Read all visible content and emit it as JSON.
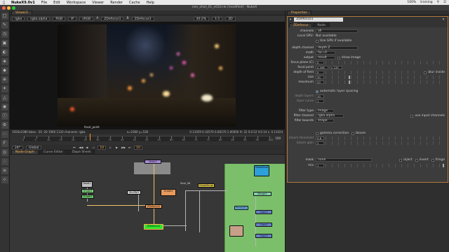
{
  "menubar": {
    "app": "NukeX9.0v1",
    "items": [
      "File",
      "Edit",
      "Workspace",
      "Viewer",
      "Render",
      "Cache",
      "Help"
    ],
    "right": {
      "status": "100%",
      "user": "training"
    }
  },
  "window_title": "nen_shot_01_v010.nk [modified] - NukeX",
  "viewer": {
    "tab": "Viewer1",
    "toolbar": {
      "layer": "rgba",
      "channel": "rgba.alpha",
      "colorspace_label": "RGB",
      "ip": "IP",
      "lut": "sRGB",
      "input_a": "A",
      "input_a_node": "ZDefocus1",
      "input_b": "B",
      "input_b_node": "ZDefocus1",
      "zoom": "40.2%",
      "aspect": "1:1",
      "mode": "2D"
    },
    "focus_point_label": "focal_point",
    "status_left": "1920x1080 bbox: -20 -20 1960 1120 channels: rgba",
    "status_mid": "x=1060 y=530",
    "status_right": "0.11059 0.10570 0.08170 1.00000  H: 32 S:0.52 V:0.14 L: 0.11024",
    "timeline_ticks": [
      "1",
      "5",
      "10",
      "15",
      "20",
      "25",
      "30",
      "35",
      "40",
      "45",
      "50",
      "55",
      "60",
      "65",
      "70",
      "75",
      "80",
      "85",
      "90",
      "95",
      "100"
    ],
    "timeline_end": "100",
    "playback": {
      "fps": "24*",
      "mode": "Global",
      "frame": "10",
      "step": "10"
    }
  },
  "nodegraph": {
    "tabs": [
      "Node Graph",
      "Curve Editor",
      "Dope Sheet"
    ],
    "nodes": {
      "read1": "Read1",
      "write": "Write1",
      "grade": "Grade1",
      "zdefocus": "ZDefocus1",
      "merge": "Merge1",
      "shuffle": "Shuffle1",
      "dot_label": "Shot_08",
      "deepmerge": "DeepMerge",
      "deepread": "DeepRead",
      "premult": "Premult1",
      "copy": "Copy1"
    }
  },
  "properties": {
    "tab": "Properties",
    "node_name": "ZDefocus1",
    "subtabs": [
      "ZDefocus",
      "Node"
    ],
    "rows": {
      "channels_label": "channels",
      "channels_val": "all",
      "localgpu_label": "Local GPU:",
      "localgpu_val": "Not available",
      "usegpu_label": "Use GPU if available",
      "depth_label": "depth channel",
      "depth_val": "depth.Z",
      "math_label": "math",
      "math_val": "far=0",
      "output_label": "output",
      "output_val": "result",
      "showimage_label": "show image",
      "focusplane_label": "focus plane (C)",
      "focusplane_val": "0",
      "focalpoint_label": "focal point",
      "focalpoint_x": "x 206",
      "focalpoint_y": "y 120",
      "dof_label": "depth of field",
      "dof_val": "0",
      "blurinside_label": "blur inside",
      "size_label": "size",
      "size_val": "20",
      "maximum_label": "maximum",
      "maximum_val": "20",
      "autolayer_label": "automatic layer spacing",
      "depthlayers_label": "depth layers",
      "depthlayers_val": "10",
      "layercurve_label": "layer curve",
      "layercurve_val": "1",
      "filtertype_label": "filter type",
      "filtertype_val": "image",
      "filterchannel_label": "filter channel",
      "filterchannel_val": "rgba.alpha",
      "useinput_label": "use input channels",
      "filterbounds_label": "filter bounds",
      "filterbounds_val": "shape",
      "gamma_label": "gamma correction",
      "bloom_label": "bloom",
      "bloomthresh_label": "bloom threshold",
      "bloomthresh_val": "0.8",
      "bloomgain_label": "bloom gain",
      "bloomgain_val": "2",
      "mask_label": "mask",
      "mask_val": "none",
      "inject_label": "inject",
      "invert_label": "invert",
      "fringe_label": "fringe",
      "mix_label": "mix",
      "mix_val": "1"
    },
    "slider_levels": {
      "size": 0.2,
      "maximum": 0.2,
      "mix": 1.0
    }
  },
  "colors": {
    "accent": "#ffb34d",
    "selected_border": "#b0763c",
    "backdrop_green": "#7bbf6a"
  }
}
